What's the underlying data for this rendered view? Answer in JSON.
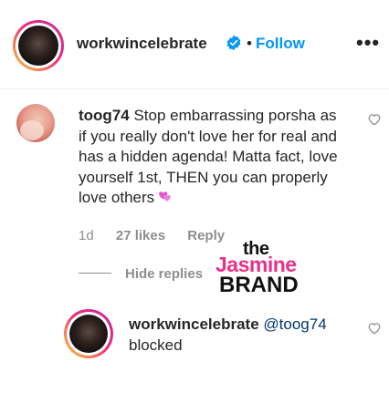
{
  "header": {
    "username": "workwincelebrate",
    "separator": "•",
    "follow_label": "Follow",
    "more_label": "•••"
  },
  "comment": {
    "username": "toog74",
    "text": "Stop embarrassing porsha as if you really don't love her for real and has a hidden agenda! Matta fact, love yourself 1st, THEN you can properly love others",
    "emoji": "sparkling-heart-icon",
    "age": "1d",
    "likes": "27 likes",
    "reply_label": "Reply"
  },
  "thread": {
    "hide_replies_label": "Hide replies"
  },
  "reply": {
    "username": "workwincelebrate",
    "mention": "@toog74",
    "text": "blocked"
  },
  "watermark": {
    "the": "the",
    "jasmine": "Jasmine",
    "brand": "BRAND"
  },
  "colors": {
    "link_blue": "#0095f6",
    "muted_gray": "#8e8e8e",
    "text": "#262626",
    "watermark_pink": "#e8318a"
  }
}
